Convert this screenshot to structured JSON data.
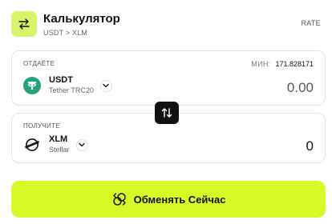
{
  "header": {
    "title": "Калькулятор",
    "pair": "USDT > XLM",
    "rate_label": "RATE",
    "icon": "swap-horizontal-icon"
  },
  "send": {
    "label": "ОТДАЁТЕ",
    "min_label": "МИН:",
    "min_value": "171.828171",
    "symbol": "USDT",
    "network": "Tether TRC20",
    "amount": "0.00",
    "logo_color": "#26a17b"
  },
  "receive": {
    "label": "ПОЛУЧИТЕ",
    "symbol": "XLM",
    "network": "Stellar",
    "amount": "0"
  },
  "swap": {
    "icon": "swap-vertical-icon"
  },
  "cta": {
    "label": "Обменять Сейчас",
    "color": "#d6f928"
  }
}
